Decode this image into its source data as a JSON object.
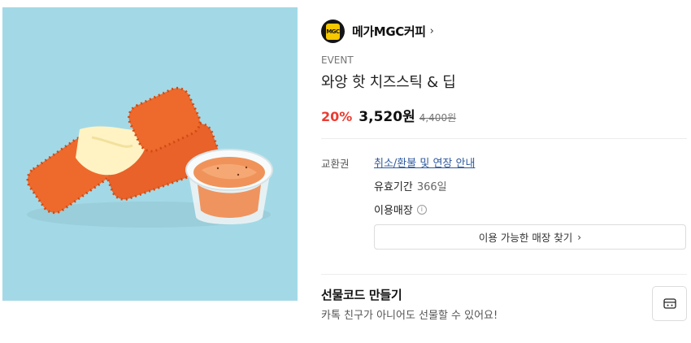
{
  "product": {
    "image_alt": "와앙 핫 치즈스틱 & 딥"
  },
  "brand": {
    "name": "메가MGC커피",
    "logo_text": "MGC",
    "chevron": "›"
  },
  "category": "EVENT",
  "title": "와앙 핫 치즈스틱 & 딥",
  "price": {
    "discount": "20%",
    "sale": "3,520원",
    "original": "4,400원"
  },
  "details": {
    "ticket_label": "교환권",
    "refund_link": "취소/환불 및 연장 안내",
    "validity_label": "유효기간",
    "validity_value": "366일",
    "store_label": "이용매장",
    "info_icon": "i",
    "store_button": "이용 가능한 매장 찾기",
    "store_button_chevron": "›"
  },
  "gift": {
    "title": "선물코드 만들기",
    "subtitle": "카톡 친구가 아니어도 선물할 수 있어요!"
  },
  "colors": {
    "image_background": "#a3d9e6",
    "discount": "#ec3b31",
    "link": "#2f5a9e",
    "brand_logo_bg": "#141414",
    "brand_logo_mark": "#f5c800"
  }
}
